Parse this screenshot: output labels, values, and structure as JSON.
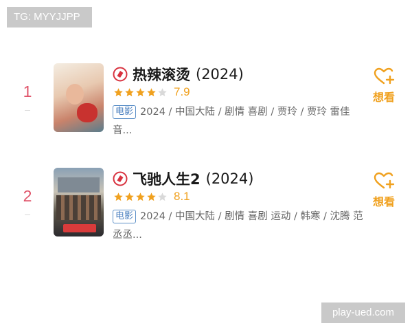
{
  "watermarks": {
    "top_left": "TG: MYYJJPP",
    "bottom_right": "play-ued.com"
  },
  "colors": {
    "rank": "#e0546a",
    "accent": "#f0a11f",
    "tag": "#4a7fbf"
  },
  "movies": [
    {
      "rank": "1",
      "title": "热辣滚烫",
      "year": "(2024)",
      "stars": 4,
      "score": "7.9",
      "tag": "电影",
      "description": "2024 / 中国大陆 / 剧情 喜剧 / 贾玲 / 贾玲 雷佳音...",
      "want_label": "想看",
      "icons": [
        "play-icon",
        "star-icon",
        "heart-plus-icon"
      ]
    },
    {
      "rank": "2",
      "title": "飞驰人生2",
      "year": "(2024)",
      "stars": 4,
      "score": "8.1",
      "tag": "电影",
      "description": "2024 / 中国大陆 / 剧情 喜剧 运动 / 韩寒 / 沈腾 范丞丞...",
      "want_label": "想看",
      "icons": [
        "play-icon",
        "star-icon",
        "heart-plus-icon"
      ]
    }
  ]
}
